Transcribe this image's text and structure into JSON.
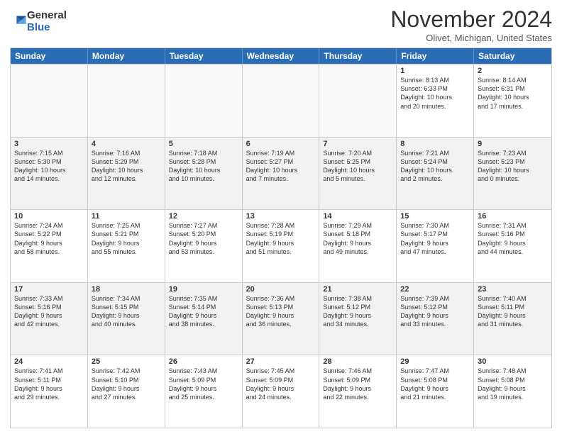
{
  "logo": {
    "general": "General",
    "blue": "Blue"
  },
  "title": "November 2024",
  "location": "Olivet, Michigan, United States",
  "days_of_week": [
    "Sunday",
    "Monday",
    "Tuesday",
    "Wednesday",
    "Thursday",
    "Friday",
    "Saturday"
  ],
  "weeks": [
    [
      {
        "day": "",
        "info": "",
        "empty": true
      },
      {
        "day": "",
        "info": "",
        "empty": true
      },
      {
        "day": "",
        "info": "",
        "empty": true
      },
      {
        "day": "",
        "info": "",
        "empty": true
      },
      {
        "day": "",
        "info": "",
        "empty": true
      },
      {
        "day": "1",
        "info": "Sunrise: 8:13 AM\nSunset: 6:33 PM\nDaylight: 10 hours\nand 20 minutes."
      },
      {
        "day": "2",
        "info": "Sunrise: 8:14 AM\nSunset: 6:31 PM\nDaylight: 10 hours\nand 17 minutes."
      }
    ],
    [
      {
        "day": "3",
        "info": "Sunrise: 7:15 AM\nSunset: 5:30 PM\nDaylight: 10 hours\nand 14 minutes."
      },
      {
        "day": "4",
        "info": "Sunrise: 7:16 AM\nSunset: 5:29 PM\nDaylight: 10 hours\nand 12 minutes."
      },
      {
        "day": "5",
        "info": "Sunrise: 7:18 AM\nSunset: 5:28 PM\nDaylight: 10 hours\nand 10 minutes."
      },
      {
        "day": "6",
        "info": "Sunrise: 7:19 AM\nSunset: 5:27 PM\nDaylight: 10 hours\nand 7 minutes."
      },
      {
        "day": "7",
        "info": "Sunrise: 7:20 AM\nSunset: 5:25 PM\nDaylight: 10 hours\nand 5 minutes."
      },
      {
        "day": "8",
        "info": "Sunrise: 7:21 AM\nSunset: 5:24 PM\nDaylight: 10 hours\nand 2 minutes."
      },
      {
        "day": "9",
        "info": "Sunrise: 7:23 AM\nSunset: 5:23 PM\nDaylight: 10 hours\nand 0 minutes."
      }
    ],
    [
      {
        "day": "10",
        "info": "Sunrise: 7:24 AM\nSunset: 5:22 PM\nDaylight: 9 hours\nand 58 minutes."
      },
      {
        "day": "11",
        "info": "Sunrise: 7:25 AM\nSunset: 5:21 PM\nDaylight: 9 hours\nand 55 minutes."
      },
      {
        "day": "12",
        "info": "Sunrise: 7:27 AM\nSunset: 5:20 PM\nDaylight: 9 hours\nand 53 minutes."
      },
      {
        "day": "13",
        "info": "Sunrise: 7:28 AM\nSunset: 5:19 PM\nDaylight: 9 hours\nand 51 minutes."
      },
      {
        "day": "14",
        "info": "Sunrise: 7:29 AM\nSunset: 5:18 PM\nDaylight: 9 hours\nand 49 minutes."
      },
      {
        "day": "15",
        "info": "Sunrise: 7:30 AM\nSunset: 5:17 PM\nDaylight: 9 hours\nand 47 minutes."
      },
      {
        "day": "16",
        "info": "Sunrise: 7:31 AM\nSunset: 5:16 PM\nDaylight: 9 hours\nand 44 minutes."
      }
    ],
    [
      {
        "day": "17",
        "info": "Sunrise: 7:33 AM\nSunset: 5:16 PM\nDaylight: 9 hours\nand 42 minutes."
      },
      {
        "day": "18",
        "info": "Sunrise: 7:34 AM\nSunset: 5:15 PM\nDaylight: 9 hours\nand 40 minutes."
      },
      {
        "day": "19",
        "info": "Sunrise: 7:35 AM\nSunset: 5:14 PM\nDaylight: 9 hours\nand 38 minutes."
      },
      {
        "day": "20",
        "info": "Sunrise: 7:36 AM\nSunset: 5:13 PM\nDaylight: 9 hours\nand 36 minutes."
      },
      {
        "day": "21",
        "info": "Sunrise: 7:38 AM\nSunset: 5:12 PM\nDaylight: 9 hours\nand 34 minutes."
      },
      {
        "day": "22",
        "info": "Sunrise: 7:39 AM\nSunset: 5:12 PM\nDaylight: 9 hours\nand 33 minutes."
      },
      {
        "day": "23",
        "info": "Sunrise: 7:40 AM\nSunset: 5:11 PM\nDaylight: 9 hours\nand 31 minutes."
      }
    ],
    [
      {
        "day": "24",
        "info": "Sunrise: 7:41 AM\nSunset: 5:11 PM\nDaylight: 9 hours\nand 29 minutes."
      },
      {
        "day": "25",
        "info": "Sunrise: 7:42 AM\nSunset: 5:10 PM\nDaylight: 9 hours\nand 27 minutes."
      },
      {
        "day": "26",
        "info": "Sunrise: 7:43 AM\nSunset: 5:09 PM\nDaylight: 9 hours\nand 25 minutes."
      },
      {
        "day": "27",
        "info": "Sunrise: 7:45 AM\nSunset: 5:09 PM\nDaylight: 9 hours\nand 24 minutes."
      },
      {
        "day": "28",
        "info": "Sunrise: 7:46 AM\nSunset: 5:09 PM\nDaylight: 9 hours\nand 22 minutes."
      },
      {
        "day": "29",
        "info": "Sunrise: 7:47 AM\nSunset: 5:08 PM\nDaylight: 9 hours\nand 21 minutes."
      },
      {
        "day": "30",
        "info": "Sunrise: 7:48 AM\nSunset: 5:08 PM\nDaylight: 9 hours\nand 19 minutes."
      }
    ]
  ]
}
